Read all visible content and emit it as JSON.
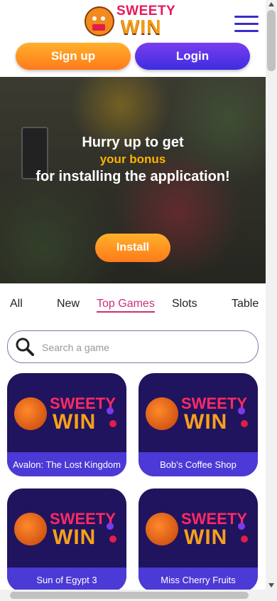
{
  "header": {
    "logo_top": "SWEETY",
    "logo_bottom": "WIN",
    "signup_label": "Sign up",
    "login_label": "Login"
  },
  "banner": {
    "line1": "Hurry up to get",
    "line2": "your bonus",
    "line3": "for installing the application!",
    "install_label": "Install"
  },
  "tabs": [
    {
      "label": "All"
    },
    {
      "label": "New"
    },
    {
      "label": "Top Games",
      "active": true
    },
    {
      "label": "Slots"
    },
    {
      "label": "Table"
    }
  ],
  "search": {
    "placeholder": "Search a game"
  },
  "games": [
    {
      "title": "Avalon: The Lost Kingdom",
      "logo_top": "SWEETY",
      "logo_bottom": "WIN"
    },
    {
      "title": "Bob's Coffee Shop",
      "logo_top": "SWEETY",
      "logo_bottom": "WIN"
    },
    {
      "title": "Sun of Egypt 3",
      "logo_top": "SWEETY",
      "logo_bottom": "WIN"
    },
    {
      "title": "Miss Cherry Fruits",
      "logo_top": "SWEETY",
      "logo_bottom": "WIN"
    }
  ],
  "colors": {
    "accent_orange": "#ff9a22",
    "accent_purple": "#4b3ad6",
    "tab_active": "#c8327a",
    "card_bg": "#20145e"
  }
}
